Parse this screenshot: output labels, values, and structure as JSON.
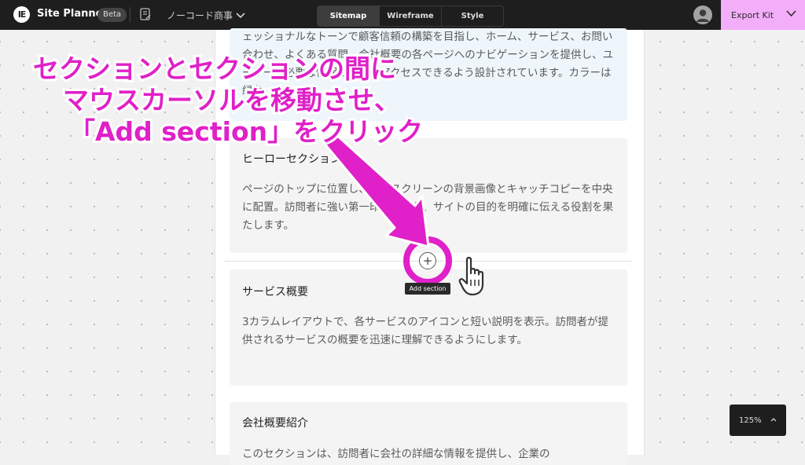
{
  "app": {
    "title": "Site Planner",
    "badge": "Beta",
    "project": "ノーコード商事"
  },
  "tabs": [
    {
      "label": "Sitemap",
      "active": true
    },
    {
      "label": "Wireframe",
      "active": false
    },
    {
      "label": "Style",
      "active": false
    }
  ],
  "export": {
    "label": "Export Kit"
  },
  "sections": [
    {
      "title": "",
      "body": "ェッショナルなトーンで顧客信頼の構築を目指し、ホーム、サービス、お問い合わせ、よくある質問、会社概要の各ページへのナビゲーションを提供し、ユーザーが必要な情報に迅速にアクセスできるよう設計されています。カラーは緑色"
    },
    {
      "title": "ヒーローセクション",
      "body": "ページのトップに位置し、フルスクリーンの背景画像とキャッチコピーを中央に配置。訪問者に強い第一印象を与え、サイトの目的を明確に伝える役割を果たします。"
    },
    {
      "title": "サービス概要",
      "body": "3カラムレイアウトで、各サービスのアイコンと短い説明を表示。訪問者が提供されるサービスの概要を迅速に理解できるようにします。"
    },
    {
      "title": "会社概要紹介",
      "body": "このセクションは、訪問者に会社の詳細な情報を提供し、企業の"
    }
  ],
  "add_section": {
    "tooltip": "Add section",
    "icon": "plus-circle-icon"
  },
  "zoom": {
    "level": "125%"
  },
  "annotation": {
    "line1": "セクションとセクションの間に",
    "line2": "マウスカーソルを移動させ、",
    "line3": "「Add section」をクリック",
    "color": "#e020c8"
  },
  "colors": {
    "topbar": "#1e1e1e",
    "export": "#f3aef9",
    "accent": "#e020c8"
  }
}
